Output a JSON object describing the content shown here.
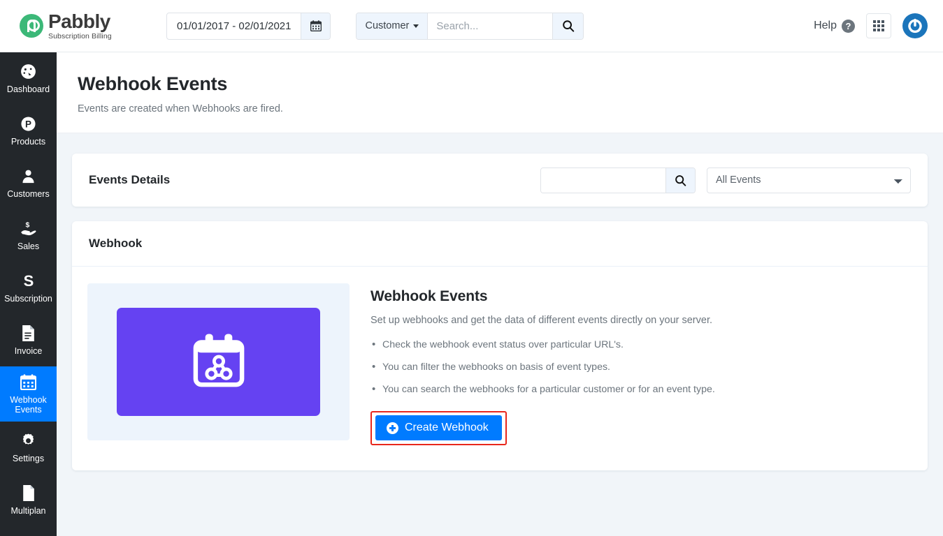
{
  "brand": {
    "name": "Pabbly",
    "tagline": "Subscription Billing",
    "logo_color": "#3cb878"
  },
  "header": {
    "date_range": "01/01/2017 - 02/01/2021",
    "calendar_icon": "calendar-icon",
    "search_scope": "Customer",
    "search_placeholder": "Search...",
    "search_value": "",
    "search_icon": "search-icon",
    "help_label": "Help",
    "help_icon": "question-mark-icon",
    "apps_icon": "grid-apps-icon",
    "avatar_icon": "power-user-avatar-icon",
    "avatar_color": "#1b75bb"
  },
  "sidebar": {
    "active_color": "#007bff",
    "background": "#23272b",
    "items": [
      {
        "label": "Dashboard",
        "icon": "speedometer-icon",
        "active": false
      },
      {
        "label": "Products",
        "icon": "p-circle-icon",
        "active": false
      },
      {
        "label": "Customers",
        "icon": "person-icon",
        "active": false
      },
      {
        "label": "Sales",
        "icon": "hand-dollar-icon",
        "active": false
      },
      {
        "label": "Subscription",
        "icon": "s-letter-icon",
        "active": false
      },
      {
        "label": "Invoice",
        "icon": "document-icon",
        "active": false
      },
      {
        "label": "Webhook\nEvents",
        "icon": "calendar-icon",
        "active": true
      },
      {
        "label": "Settings",
        "icon": "gear-icon",
        "active": false
      },
      {
        "label": "Multiplan",
        "icon": "page-icon",
        "active": false
      }
    ]
  },
  "page": {
    "title": "Webhook Events",
    "subtitle": "Events are created when Webhooks are fired."
  },
  "events_card": {
    "title": "Events Details",
    "search_value": "",
    "search_placeholder": "",
    "search_icon": "search-icon",
    "filter_selected": "All Events",
    "filter_options": [
      "All Events"
    ]
  },
  "webhook_card": {
    "header": "Webhook",
    "illustration_icon": "calendar-webhook-illustration",
    "illustration_bg": "#6542f2",
    "illustration_panel_bg": "#edf4fc",
    "title": "Webhook Events",
    "description": "Set up webhooks and get the data of different events directly on your server.",
    "bullets": [
      "Check the webhook event status over particular URL's.",
      "You can filter the webhooks on basis of event types.",
      "You can search the webhooks for a particular customer or for an event type."
    ],
    "cta_label": "Create Webhook",
    "cta_icon": "plus-circle-icon",
    "cta_color": "#007bff",
    "highlight_color": "#e8271c"
  }
}
